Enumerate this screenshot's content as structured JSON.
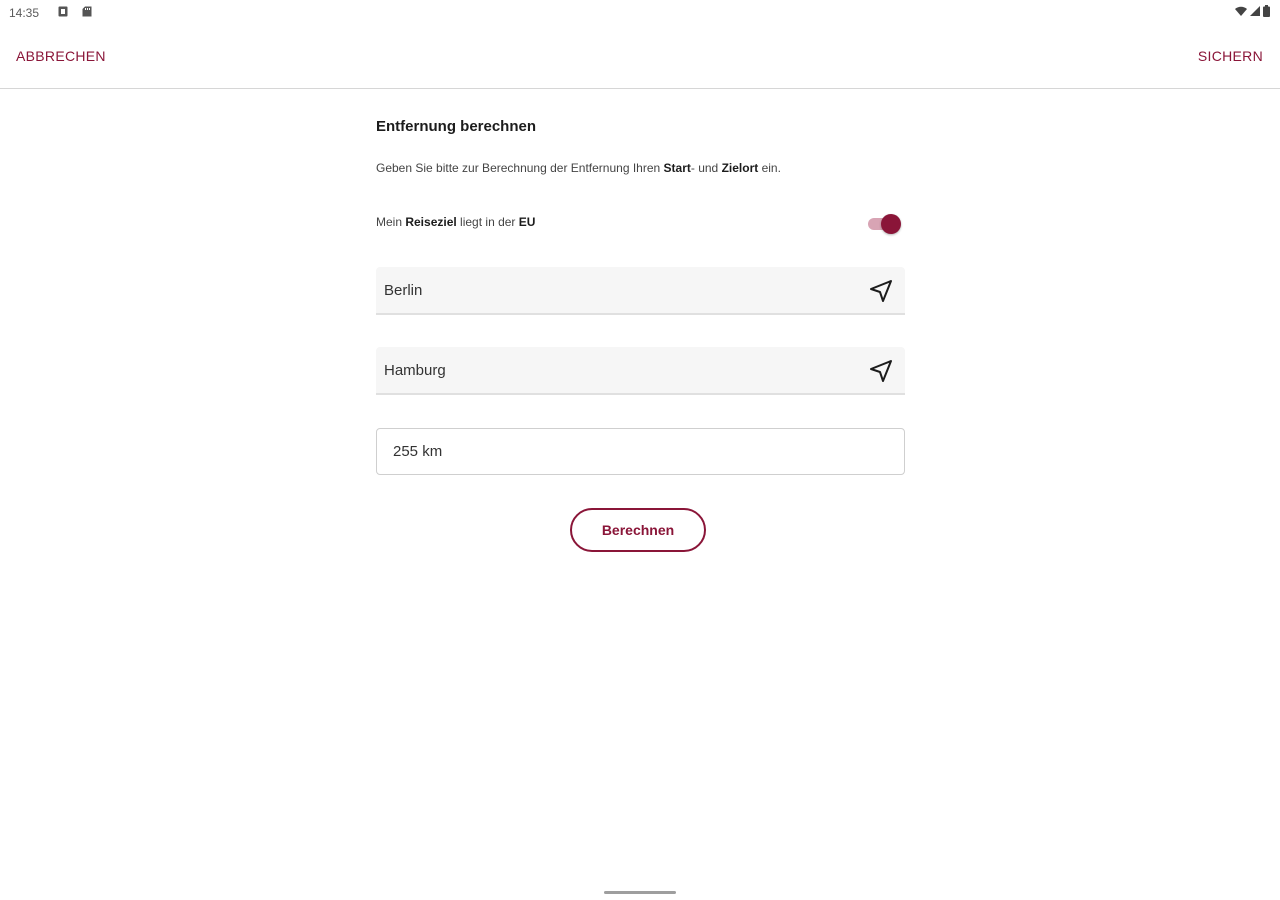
{
  "status_bar": {
    "time": "14:35"
  },
  "top_bar": {
    "cancel_label": "ABBRECHEN",
    "save_label": "SICHERN"
  },
  "form": {
    "title": "Entfernung berechnen",
    "description": {
      "part1": "Geben Sie bitte zur Berechnung der Entfernung Ihren ",
      "start": "Start",
      "part2": "- und ",
      "dest": "Zielort",
      "part3": " ein."
    },
    "eu_toggle": {
      "part1": "Mein ",
      "reiseziel": "Reiseziel",
      "part2": " liegt in der ",
      "eu": "EU",
      "checked": true
    },
    "start_location": {
      "value": "Berlin",
      "icon": "navigation-arrow-icon"
    },
    "destination_location": {
      "value": "Hamburg",
      "icon": "navigation-arrow-icon"
    },
    "distance_value": "255 km",
    "calculate_label": "Berechnen"
  },
  "colors": {
    "accent": "#8a1538",
    "toggle_track": "#d8a4b4"
  }
}
